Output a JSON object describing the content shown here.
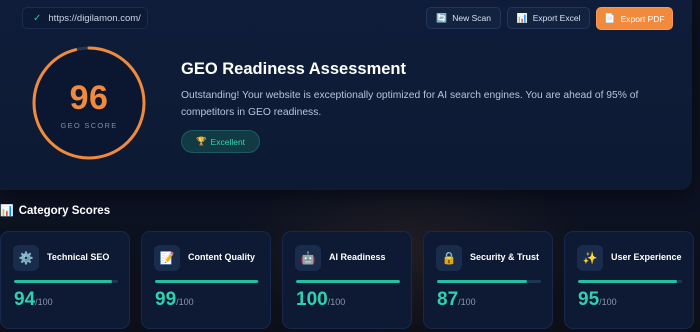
{
  "header": {
    "url": "https://digilamon.com/",
    "buttons": {
      "new_scan": "New Scan",
      "export_excel": "Export Excel",
      "export_pdf": "Export PDF"
    }
  },
  "hero": {
    "score": "96",
    "score_label": "GEO SCORE",
    "score_fraction": 0.96,
    "title": "GEO Readiness Assessment",
    "description": "Outstanding! Your website is exceptionally optimized for AI search engines. You are ahead of 95% of competitors in GEO readiness.",
    "badge": "Excellent",
    "accent_color": "#f08a3c"
  },
  "categories_section": {
    "title": "Category Scores",
    "items": [
      {
        "label": "Technical SEO",
        "score": "94",
        "max": "/100",
        "fraction": 0.94,
        "icon": "gear-icon",
        "glyph": "⚙️"
      },
      {
        "label": "Content Quality",
        "score": "99",
        "max": "/100",
        "fraction": 0.99,
        "icon": "memo-icon",
        "glyph": "📝"
      },
      {
        "label": "AI Readiness",
        "score": "100",
        "max": "/100",
        "fraction": 1.0,
        "icon": "robot-icon",
        "glyph": "🤖"
      },
      {
        "label": "Security & Trust",
        "score": "87",
        "max": "/100",
        "fraction": 0.87,
        "icon": "lock-icon",
        "glyph": "🔒"
      },
      {
        "label": "User Experience",
        "score": "95",
        "max": "/100",
        "fraction": 0.95,
        "icon": "sparkles-icon",
        "glyph": "✨"
      }
    ],
    "progress_color": "#22c1a4"
  }
}
